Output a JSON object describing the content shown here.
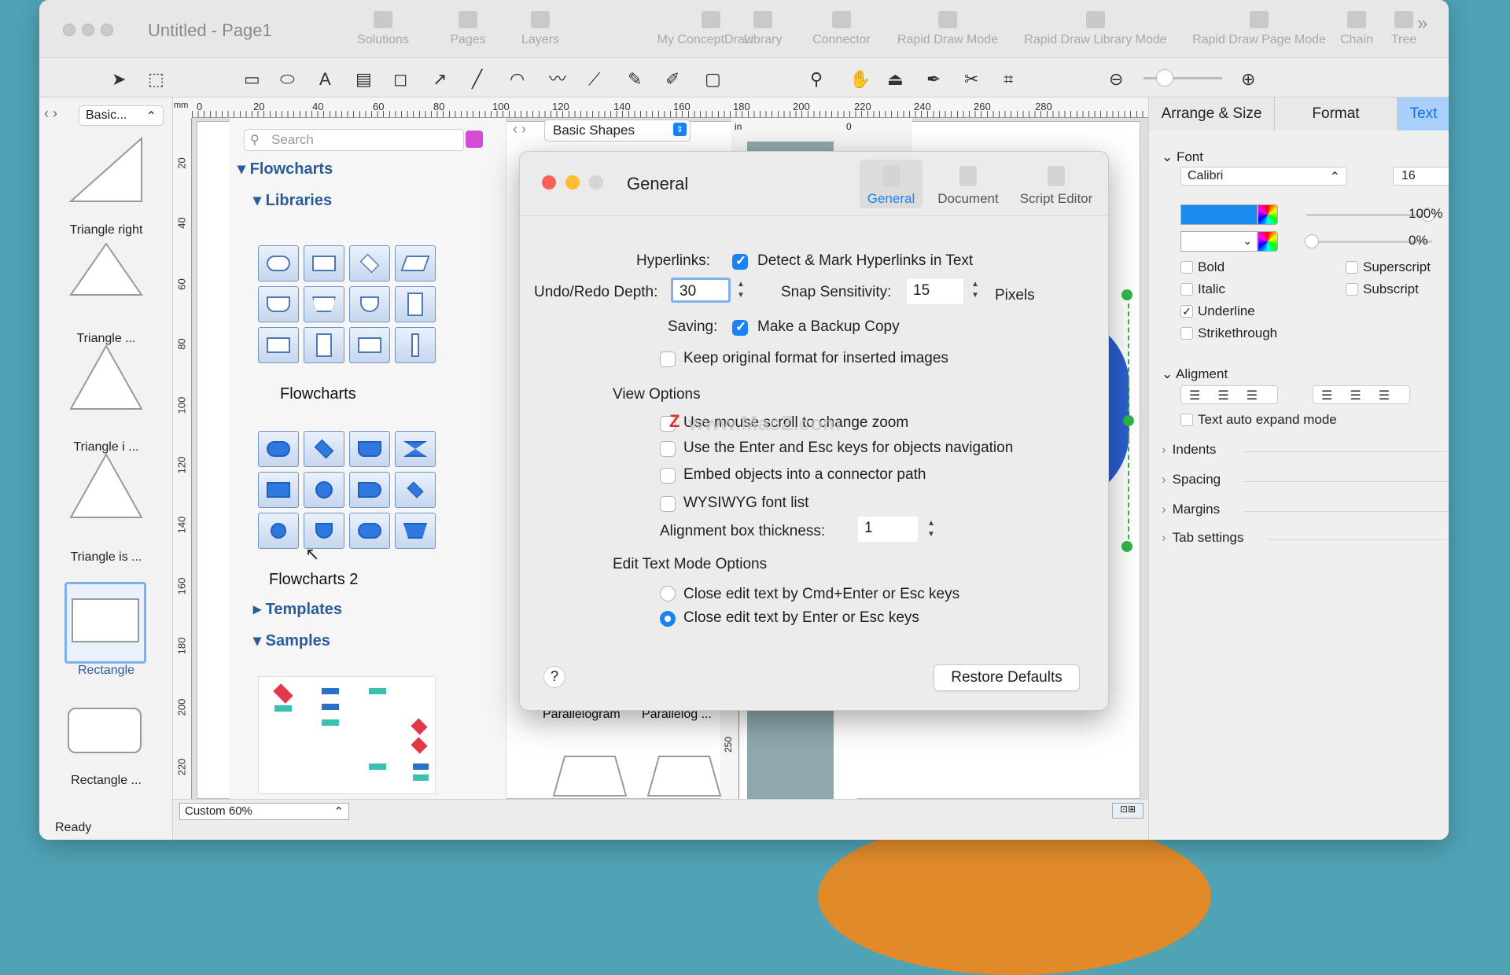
{
  "window": {
    "title": "Untitled - Page1",
    "status": "Ready",
    "zoom": "Custom 60%"
  },
  "toolbar": [
    {
      "label": "Solutions"
    },
    {
      "label": "Pages"
    },
    {
      "label": "Layers"
    },
    {
      "label": "My ConceptDraw"
    },
    {
      "label": "Library"
    },
    {
      "label": "Connector"
    },
    {
      "label": "Rapid Draw Mode"
    },
    {
      "label": "Rapid Draw Library Mode"
    },
    {
      "label": "Rapid Draw Page Mode"
    },
    {
      "label": "Chain"
    },
    {
      "label": "Tree"
    }
  ],
  "left_panel": {
    "selector": "Basic...",
    "shapes": [
      "Triangle right",
      "Triangle ...",
      "Triangle i ...",
      "Triangle is ...",
      "Rectangle",
      "Rectangle ..."
    ]
  },
  "library": {
    "search_placeholder": "Search",
    "basic_shapes": "Basic Shapes",
    "tree": {
      "flowcharts": "Flowcharts",
      "libraries": "Libraries",
      "templates": "Templates",
      "samples": "Samples"
    },
    "categories": [
      "Flowcharts",
      "Flowcharts 2"
    ],
    "canvas_labels": [
      "Parallelogram",
      "Parallelog ..."
    ]
  },
  "ruler": {
    "top": [
      "0",
      "20",
      "40",
      "60",
      "80",
      "100",
      "120",
      "140",
      "160",
      "180",
      "200",
      "220",
      "240",
      "260",
      "280"
    ],
    "left": [
      "20",
      "40",
      "60",
      "80",
      "100",
      "120",
      "140",
      "160",
      "180",
      "200",
      "220"
    ],
    "unit": "mm",
    "inner_unit": "in",
    "inner_zero": "0",
    "inner_250": "250"
  },
  "dialog": {
    "title": "General",
    "tabs": [
      "General",
      "Document",
      "Script Editor"
    ],
    "hyperlinks_label": "Hyperlinks:",
    "hyperlinks_option": "Detect & Mark Hyperlinks in Text",
    "undo_label": "Undo/Redo Depth:",
    "undo_value": "30",
    "snap_label": "Snap Sensitivity:",
    "snap_value": "15",
    "snap_unit": "Pixels",
    "saving_label": "Saving:",
    "saving_option": "Make a Backup Copy",
    "keep_format": "Keep original format for inserted images",
    "view_options": "View Options",
    "view": [
      "Use mouse scroll to change zoom",
      "Use the Enter and Esc keys for objects navigation",
      "Embed objects into a connector path",
      "WYSIWYG font list"
    ],
    "alignment_label": "Alignment box thickness:",
    "alignment_value": "1",
    "edit_text": "Edit Text Mode Options",
    "radio1": "Close edit text by Cmd+Enter or Esc keys",
    "radio2": "Close edit text by Enter or Esc keys",
    "help": "?",
    "restore": "Restore Defaults",
    "watermark": "www.MacZ.com"
  },
  "right_panel": {
    "tabs": [
      "Arrange & Size",
      "Format",
      "Text"
    ],
    "font_section": "Font",
    "font_name": "Calibri",
    "font_size": "16",
    "opacity1": "100%",
    "opacity2": "0%",
    "styles": [
      "Bold",
      "Italic",
      "Underline",
      "Strikethrough"
    ],
    "styles2": [
      "Superscript",
      "Subscript"
    ],
    "alignment_section": "Aligment",
    "auto_expand": "Text auto expand mode",
    "sections": [
      "Indents",
      "Spacing",
      "Margins",
      "Tab settings"
    ],
    "text_color": "#1a8cf0"
  }
}
